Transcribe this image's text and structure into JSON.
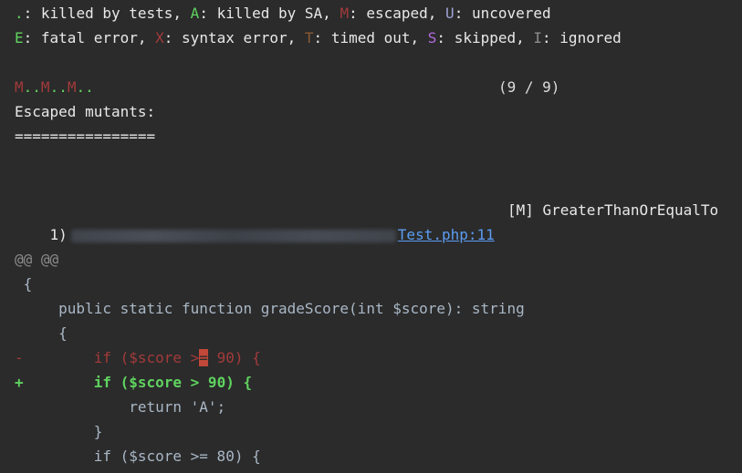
{
  "legend": {
    "line1": [
      {
        "sym": ".",
        "text": ": killed by tests, ",
        "color": "#5fd35f"
      },
      {
        "sym": "A",
        "text": ": killed by SA, ",
        "color": "#5fd35f"
      },
      {
        "sym": "M",
        "text": ": escaped, ",
        "color": "#a33a3a"
      },
      {
        "sym": "U",
        "text": ": uncovered",
        "color": "#a0a4d8"
      }
    ],
    "line2": [
      {
        "sym": "E",
        "text": ": fatal error, ",
        "color": "#5fd35f"
      },
      {
        "sym": "X",
        "text": ": syntax error, ",
        "color": "#a33a3a"
      },
      {
        "sym": "T",
        "text": ": timed out, ",
        "color": "#8a5a36"
      },
      {
        "sym": "S",
        "text": ": skipped, ",
        "color": "#b36ad9"
      },
      {
        "sym": "I",
        "text": ": ignored",
        "color": "#8c8c8c"
      }
    ]
  },
  "progress": {
    "marks": [
      {
        "c": "M",
        "kind": "escaped"
      },
      {
        "c": ".",
        "kind": "killed"
      },
      {
        "c": ".",
        "kind": "killed"
      },
      {
        "c": "M",
        "kind": "escaped"
      },
      {
        "c": ".",
        "kind": "killed"
      },
      {
        "c": ".",
        "kind": "killed"
      },
      {
        "c": "M",
        "kind": "escaped"
      },
      {
        "c": ".",
        "kind": "killed"
      },
      {
        "c": ".",
        "kind": "killed"
      }
    ],
    "count": "(9 / 9)"
  },
  "escaped": {
    "heading": "Escaped mutants:",
    "rule": "================"
  },
  "mutant": {
    "index": "1)",
    "file_link": "Test.php:11",
    "mutator": "[M] GreaterThanOrEqualTo"
  },
  "diff": {
    "hunk": "@@ @@",
    "lines": [
      {
        "marker": " ",
        "code": "{"
      },
      {
        "marker": " ",
        "code": "    public static function gradeScore(int $score): string"
      },
      {
        "marker": " ",
        "code": "    {"
      }
    ],
    "removed": {
      "marker": "-",
      "before": "        if ($score >",
      "highlight": "=",
      "after": " 90) {"
    },
    "added": {
      "marker": "+",
      "code": "        if ($score > 90) {"
    },
    "tail": [
      {
        "marker": " ",
        "code": "            return 'A';"
      },
      {
        "marker": " ",
        "code": "        }"
      },
      {
        "marker": " ",
        "code": "        if ($score >= 80) {"
      }
    ]
  }
}
